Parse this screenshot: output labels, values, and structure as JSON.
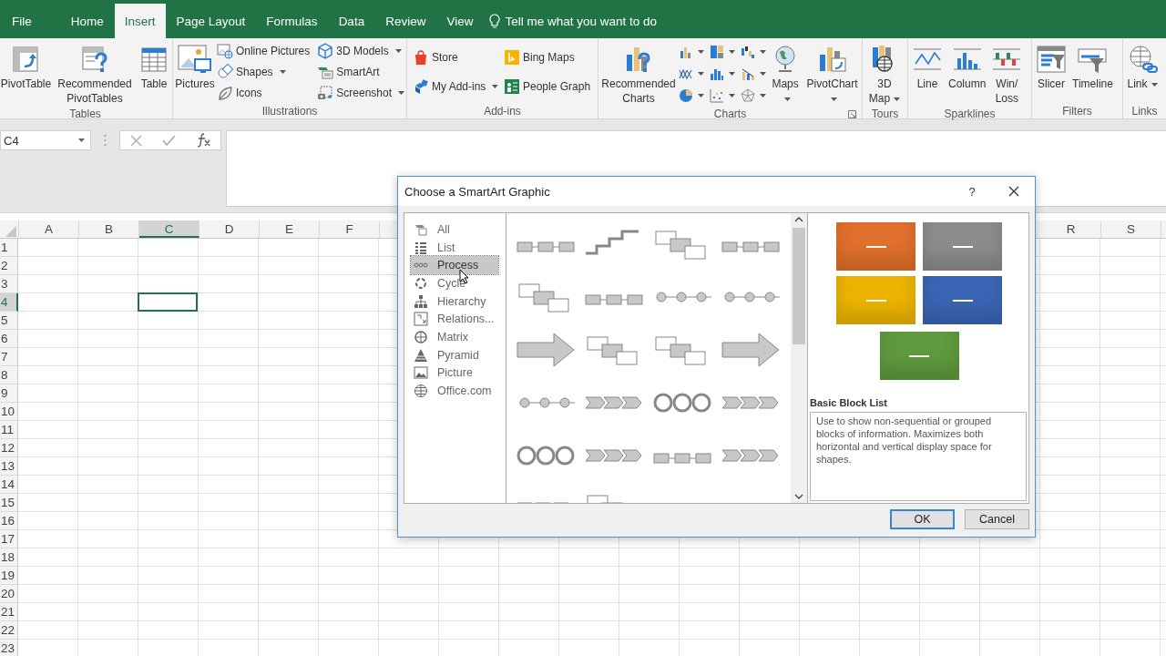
{
  "menu_tabs": [
    {
      "label": "File",
      "selected": false
    },
    {
      "label": "Home",
      "selected": false
    },
    {
      "label": "Insert",
      "selected": true
    },
    {
      "label": "Page Layout",
      "selected": false
    },
    {
      "label": "Formulas",
      "selected": false
    },
    {
      "label": "Data",
      "selected": false
    },
    {
      "label": "Review",
      "selected": false
    },
    {
      "label": "View",
      "selected": false
    }
  ],
  "tell_me": {
    "placeholder": "Tell me what you want to do"
  },
  "ribbon": [
    {
      "label": "Tables",
      "buttons": [
        {
          "kind": "large",
          "label": "PivotTable"
        },
        {
          "kind": "large",
          "label": "Recommended PivotTables"
        },
        {
          "kind": "large",
          "label": "Table"
        }
      ]
    },
    {
      "label": "Illustrations",
      "buttons": [
        {
          "kind": "large",
          "label": "Pictures"
        },
        {
          "kind": "small",
          "label": "Online Pictures"
        },
        {
          "kind": "small",
          "label": "Shapes",
          "dropdown": true
        },
        {
          "kind": "small",
          "label": "Icons"
        },
        {
          "kind": "small",
          "label": "3D Models",
          "dropdown": true
        },
        {
          "kind": "small",
          "label": "SmartArt"
        },
        {
          "kind": "small",
          "label": "Screenshot",
          "dropdown": true
        }
      ]
    },
    {
      "label": "Add-ins",
      "buttons": [
        {
          "kind": "small",
          "label": "Store"
        },
        {
          "kind": "small",
          "label": "Bing Maps"
        },
        {
          "kind": "small",
          "label": "My Add-ins",
          "dropdown": true
        },
        {
          "kind": "small",
          "label": "People Graph"
        }
      ]
    },
    {
      "label": "Charts",
      "launcher": true,
      "buttons": [
        {
          "kind": "large",
          "label": "Recommended Charts"
        },
        {
          "kind": "icon",
          "dropdown": true
        },
        {
          "kind": "icon",
          "dropdown": true
        },
        {
          "kind": "icon",
          "dropdown": true
        },
        {
          "kind": "icon",
          "dropdown": true
        },
        {
          "kind": "icon",
          "dropdown": true
        },
        {
          "kind": "icon",
          "dropdown": true
        },
        {
          "kind": "icon",
          "dropdown": true
        },
        {
          "kind": "icon",
          "dropdown": true
        },
        {
          "kind": "icon",
          "dropdown": true
        },
        {
          "kind": "large",
          "label": "Maps",
          "dropdown": true
        },
        {
          "kind": "large",
          "label": "PivotChart",
          "dropdown": true
        }
      ]
    },
    {
      "label": "Tours",
      "buttons": [
        {
          "kind": "large",
          "label": "3D Map",
          "dropdown": true
        }
      ]
    },
    {
      "label": "Sparklines",
      "buttons": [
        {
          "kind": "large",
          "label": "Line"
        },
        {
          "kind": "large",
          "label": "Column"
        },
        {
          "kind": "large",
          "label": "Win/Loss"
        }
      ]
    },
    {
      "label": "Filters",
      "buttons": [
        {
          "kind": "large",
          "label": "Slicer"
        },
        {
          "kind": "large",
          "label": "Timeline"
        }
      ]
    },
    {
      "label": "Links",
      "buttons": [
        {
          "kind": "large",
          "label": "Link",
          "dropdown": true
        }
      ]
    }
  ],
  "formula_bar": {
    "name_box": "C4"
  },
  "grid": {
    "columns": [
      {
        "label": "A",
        "selected": false
      },
      {
        "label": "B",
        "selected": false
      },
      {
        "label": "C",
        "selected": true
      },
      {
        "label": "D",
        "selected": false
      },
      {
        "label": "E",
        "selected": false
      },
      {
        "label": "F",
        "selected": false
      }
    ],
    "columns_right": [
      {
        "label": "R",
        "selected": false
      },
      {
        "label": "S",
        "selected": false
      }
    ],
    "rows": [
      {
        "label": "1",
        "selected": false
      },
      {
        "label": "2",
        "selected": false
      },
      {
        "label": "3",
        "selected": false
      },
      {
        "label": "4",
        "selected": true
      },
      {
        "label": "5",
        "selected": false
      },
      {
        "label": "6",
        "selected": false
      },
      {
        "label": "7",
        "selected": false
      },
      {
        "label": "8",
        "selected": false
      },
      {
        "label": "9",
        "selected": false
      },
      {
        "label": "10",
        "selected": false
      },
      {
        "label": "11",
        "selected": false
      },
      {
        "label": "12",
        "selected": false
      },
      {
        "label": "13",
        "selected": false
      },
      {
        "label": "14",
        "selected": false
      },
      {
        "label": "15",
        "selected": false
      },
      {
        "label": "16",
        "selected": false
      },
      {
        "label": "17",
        "selected": false
      },
      {
        "label": "18",
        "selected": false
      },
      {
        "label": "19",
        "selected": false
      },
      {
        "label": "20",
        "selected": false
      },
      {
        "label": "21",
        "selected": false
      },
      {
        "label": "22",
        "selected": false
      },
      {
        "label": "23",
        "selected": false
      }
    ]
  },
  "dialog": {
    "title": "Choose a SmartArt Graphic",
    "help": "?",
    "categories": [
      {
        "label": "All",
        "selected": false
      },
      {
        "label": "List",
        "selected": false
      },
      {
        "label": "Process",
        "selected": true
      },
      {
        "label": "Cycle",
        "selected": false
      },
      {
        "label": "Hierarchy",
        "selected": false
      },
      {
        "label": "Relations...",
        "selected": false
      },
      {
        "label": "Matrix",
        "selected": false
      },
      {
        "label": "Pyramid",
        "selected": false
      },
      {
        "label": "Picture",
        "selected": false
      },
      {
        "label": "Office.com",
        "selected": false
      }
    ],
    "gallery": [
      {
        "kind": "blocks"
      },
      {
        "kind": "steps"
      },
      {
        "kind": "stack"
      },
      {
        "kind": "blocks"
      },
      {
        "kind": "stack"
      },
      {
        "kind": "blocks"
      },
      {
        "kind": "dots"
      },
      {
        "kind": "dots"
      },
      {
        "kind": "arrow"
      },
      {
        "kind": "stack"
      },
      {
        "kind": "stack"
      },
      {
        "kind": "arrow"
      },
      {
        "kind": "dots"
      },
      {
        "kind": "chevrons"
      },
      {
        "kind": "rings"
      },
      {
        "kind": "chevrons"
      },
      {
        "kind": "rings"
      },
      {
        "kind": "chevrons"
      },
      {
        "kind": "blocks"
      },
      {
        "kind": "chevrons"
      },
      {
        "kind": "chevrons"
      },
      {
        "kind": "stack"
      }
    ],
    "preview": {
      "blocks": [
        {
          "color": "#e0702b"
        },
        {
          "color": "#8c8c8c"
        },
        {
          "color": "#ecb400"
        },
        {
          "color": "#3b65b4"
        },
        {
          "color": "#5f9a3e"
        }
      ],
      "title": "Basic Block List",
      "description": "Use to show non-sequential or grouped blocks of information. Maximizes both horizontal and vertical display space for shapes."
    },
    "buttons": [
      {
        "label": "OK",
        "default": true
      },
      {
        "label": "Cancel",
        "default": false
      }
    ]
  }
}
